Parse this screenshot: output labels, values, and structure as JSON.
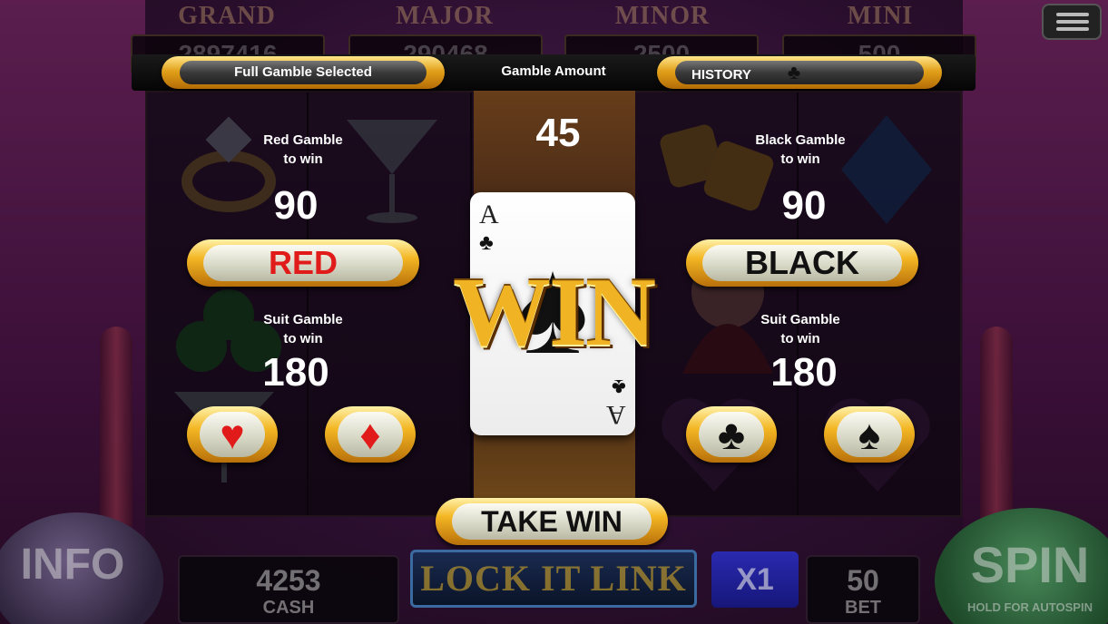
{
  "jackpots": [
    {
      "name": "GRAND",
      "value": "2897416",
      "color": "#3a8a3a"
    },
    {
      "name": "MAJOR",
      "value": "290468",
      "color": "#2a6a3a"
    },
    {
      "name": "MINOR",
      "value": "2500",
      "color": "#6a2a8a"
    },
    {
      "name": "MINI",
      "value": "500",
      "color": "#2a3a8a"
    }
  ],
  "topbar": {
    "full_gamble": "Full Gamble Selected",
    "gamble_amount_label": "Gamble Amount",
    "history_label": "HISTORY",
    "history_icon": "club-icon"
  },
  "gamble_amount": "45",
  "red_gamble": {
    "label_line1": "Red Gamble",
    "label_line2": "to win",
    "value": "90",
    "button": "RED"
  },
  "black_gamble": {
    "label_line1": "Black Gamble",
    "label_line2": "to win",
    "value": "90",
    "button": "BLACK"
  },
  "suit_gamble_left": {
    "label_line1": "Suit Gamble",
    "label_line2": "to win",
    "value": "180"
  },
  "suit_gamble_right": {
    "label_line1": "Suit Gamble",
    "label_line2": "to win",
    "value": "180"
  },
  "suits": {
    "heart": "♥",
    "diamond": "♦",
    "club": "♣",
    "spade": "♠"
  },
  "card": {
    "rank": "A",
    "suit": "♣",
    "center_suit": "♠"
  },
  "result": "WIN",
  "take_win": "TAKE WIN",
  "bottom": {
    "info": "INFO",
    "cash_value": "4253",
    "cash_label": "CASH",
    "logo": "LOCK IT LINK",
    "multiplier": "X1",
    "bet_value": "50",
    "bet_label": "BET",
    "spin": "SPIN",
    "spin_sub": "HOLD FOR AUTOSPIN"
  },
  "colors": {
    "gold": "#f0b323",
    "red_text": "#e11a1a",
    "black_text": "#111111"
  }
}
